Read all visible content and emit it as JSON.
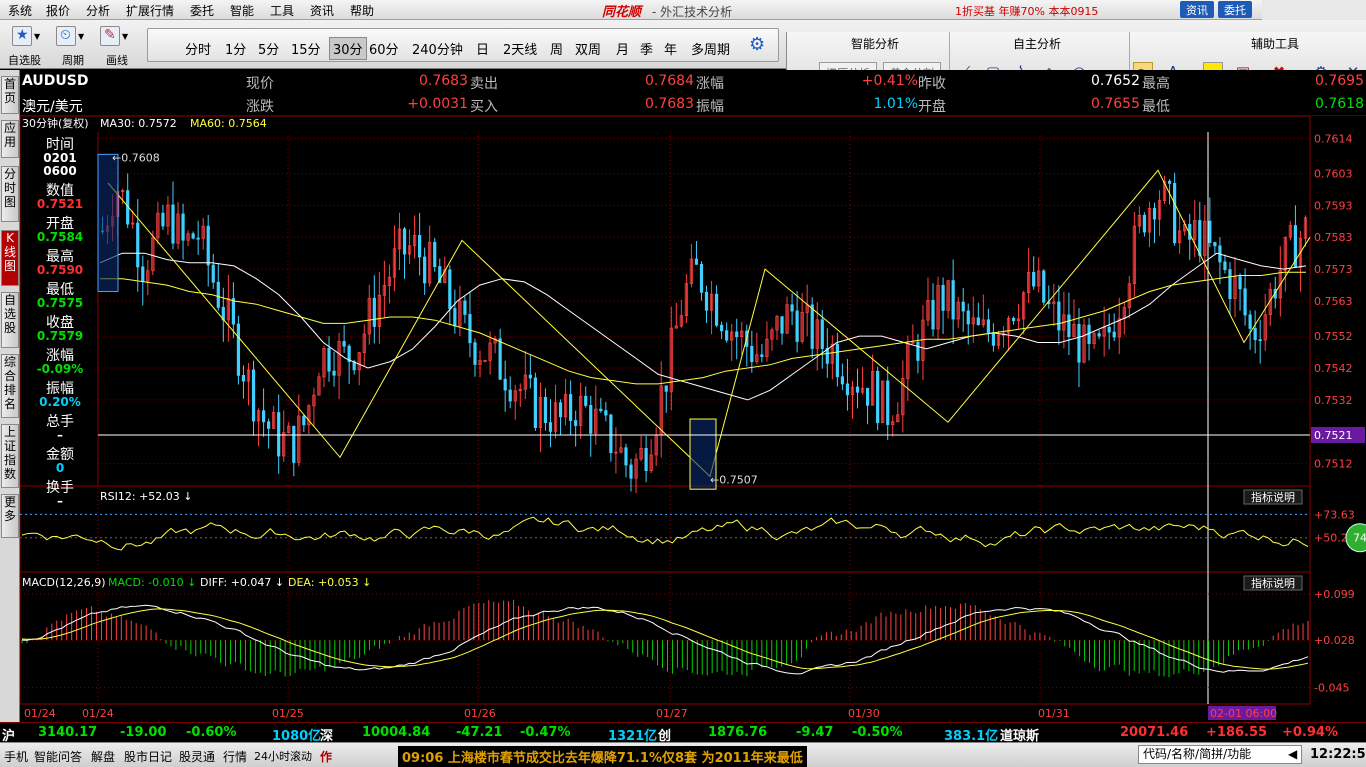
{
  "menu": [
    "系统",
    "报价",
    "分析",
    "扩展行情",
    "委托",
    "智能",
    "工具",
    "资讯",
    "帮助"
  ],
  "brand": "同花顺",
  "window_subtitle": "- 外汇技术分析",
  "promo_text": "1折买基 年赚70%   本本0915",
  "top_pills": [
    "资讯",
    "委托"
  ],
  "toolbar": {
    "left_buttons": [
      "自选股",
      "周期",
      "画线"
    ],
    "periods": [
      "分时",
      "1分",
      "5分",
      "15分",
      "30分",
      "60分",
      "240分钟",
      "日",
      "2天线",
      "周",
      "双周",
      "月",
      "季",
      "年",
      "多周期"
    ],
    "active_period": "30分",
    "panel_heads": [
      "智能分析",
      "自主分析",
      "辅助工具"
    ],
    "panel_buttons": [
      "撑压分析",
      "黄金分割"
    ]
  },
  "left_tabs": [
    "首页",
    "应用",
    "分时图",
    "K线图",
    "自选股",
    "综合排名",
    "上证指数",
    "更多"
  ],
  "quote": {
    "symbol": "AUDUSD",
    "name": "澳元/美元",
    "labels": {
      "now": "现价",
      "change": "涨跌",
      "sell": "卖出",
      "buy": "买入",
      "pct": "涨幅",
      "amp": "振幅",
      "prev": "昨收",
      "open": "开盘",
      "high": "最高",
      "low": "最低"
    },
    "values": {
      "now": "0.7683",
      "change": "+0.0031",
      "sell": "0.7684",
      "buy": "0.7683",
      "pct": "+0.41%",
      "amp": "1.01%",
      "prev": "0.7652",
      "open": "0.7655",
      "high": "0.7695",
      "low": "0.7618"
    }
  },
  "chart_header": {
    "period_label": "30分钟(复权)",
    "ma30": "MA30: 0.7572",
    "ma60": "MA60: 0.7564"
  },
  "info_panel": [
    {
      "label": "时间",
      "value": "0201\n0600",
      "color": "#ffffff"
    },
    {
      "label": "数值",
      "value": "0.7521",
      "color": "#ff3030"
    },
    {
      "label": "开盘",
      "value": "0.7584",
      "color": "#00e000"
    },
    {
      "label": "最高",
      "value": "0.7590",
      "color": "#ff3030"
    },
    {
      "label": "最低",
      "value": "0.7575",
      "color": "#00e000"
    },
    {
      "label": "收盘",
      "value": "0.7579",
      "color": "#00e000"
    },
    {
      "label": "涨幅",
      "value": "-0.09%",
      "color": "#00e000"
    },
    {
      "label": "振幅",
      "value": "0.20%",
      "color": "#00d0ff"
    },
    {
      "label": "总手",
      "value": "–",
      "color": "#ffffff"
    },
    {
      "label": "金额",
      "value": "0",
      "color": "#00d0ff"
    },
    {
      "label": "换手",
      "value": "–",
      "color": "#ffffff"
    }
  ],
  "chart_data": {
    "type": "candlestick",
    "price_ticks": [
      "0.7614",
      "0.7603",
      "0.7593",
      "0.7583",
      "0.7573",
      "0.7563",
      "0.7552",
      "0.7542",
      "0.7532",
      "0.7521",
      "0.7512"
    ],
    "ylim": [
      0.7505,
      0.7616
    ],
    "cursor_value": "0.7521",
    "high_marker": "0.7608",
    "low_marker": "0.7507",
    "x_labels": [
      "01/24",
      "01/24",
      "01/25",
      "01/26",
      "01/27",
      "01/30",
      "01/31",
      "02-01 06:00"
    ],
    "close_path": [
      0.7585,
      0.76,
      0.759,
      0.7575,
      0.7582,
      0.759,
      0.758,
      0.7585,
      0.7572,
      0.756,
      0.7548,
      0.7535,
      0.7525,
      0.752,
      0.7518,
      0.7525,
      0.7545,
      0.7548,
      0.7545,
      0.755,
      0.756,
      0.757,
      0.7578,
      0.758,
      0.7575,
      0.7568,
      0.756,
      0.7552,
      0.7548,
      0.7545,
      0.754,
      0.7535,
      0.753,
      0.7528,
      0.7525,
      0.753,
      0.7528,
      0.7522,
      0.7518,
      0.751,
      0.7515,
      0.7528,
      0.7545,
      0.7565,
      0.7572,
      0.7565,
      0.7558,
      0.7552,
      0.7548,
      0.7545,
      0.7555,
      0.756,
      0.7555,
      0.755,
      0.7548,
      0.7542,
      0.7538,
      0.7535,
      0.7528,
      0.7535,
      0.7548,
      0.7555,
      0.7565,
      0.756,
      0.7555,
      0.7552,
      0.7555,
      0.756,
      0.7565,
      0.7568,
      0.756,
      0.7555,
      0.7552,
      0.7545,
      0.7548,
      0.756,
      0.7575,
      0.759,
      0.7598,
      0.7592,
      0.758,
      0.7585,
      0.7578,
      0.7572,
      0.7566,
      0.7552,
      0.756,
      0.7572,
      0.758,
      0.7585
    ],
    "ma_fast": [
      0.7575,
      0.7578,
      0.7578,
      0.7576,
      0.7575,
      0.7575,
      0.7574,
      0.757,
      0.7565,
      0.7558,
      0.755,
      0.7545,
      0.7542,
      0.7544,
      0.7548,
      0.7555,
      0.7563,
      0.7568,
      0.757,
      0.7569,
      0.7565,
      0.756,
      0.7555,
      0.755,
      0.7545,
      0.754,
      0.7538,
      0.7536,
      0.7534,
      0.7532,
      0.7535,
      0.754,
      0.7545,
      0.755,
      0.7552,
      0.7552,
      0.755,
      0.7548,
      0.755,
      0.7552,
      0.7553,
      0.7552,
      0.755,
      0.755,
      0.7552,
      0.7555,
      0.7558,
      0.7562,
      0.7568,
      0.7573,
      0.7578,
      0.7576,
      0.7574,
      0.7573,
      0.7574
    ],
    "ma_slow": [
      0.757,
      0.757,
      0.7569,
      0.7568,
      0.7566,
      0.7565,
      0.7563,
      0.7562,
      0.756,
      0.7558,
      0.7556,
      0.7556,
      0.7557,
      0.7558,
      0.7558,
      0.7557,
      0.7555,
      0.7553,
      0.755,
      0.7547,
      0.7544,
      0.7541,
      0.7539,
      0.7538,
      0.7537,
      0.7537,
      0.7538,
      0.7539,
      0.7541,
      0.7542,
      0.7543,
      0.7545,
      0.7546,
      0.7547,
      0.7548,
      0.7549,
      0.755,
      0.7551,
      0.7551,
      0.7552,
      0.7553,
      0.7554,
      0.7555,
      0.7556,
      0.7558,
      0.756,
      0.7563,
      0.7566,
      0.7568,
      0.7569,
      0.757,
      0.7571,
      0.7571,
      0.7572,
      0.7572
    ],
    "zigzag": [
      0.76,
      0.7514,
      0.7582,
      0.7508,
      0.7573,
      0.7525,
      0.7604,
      0.755,
      0.7583
    ],
    "rsi": {
      "label": "RSI12: +52.03",
      "ticks": [
        "+73.63",
        "+50.27"
      ],
      "badge": "74"
    },
    "macd": {
      "label": "MACD(12,26,9)",
      "macd": "MACD: -0.010",
      "diff": "DIFF: +0.047",
      "dea": "DEA: +0.053",
      "ticks": [
        "+0.099",
        "+0.028",
        "-0.045"
      ]
    },
    "indicator_button": "指标说明"
  },
  "index_bar": [
    {
      "text": "沪",
      "color": "#ffffff"
    },
    {
      "text": "3140.17",
      "color": "#00e000"
    },
    {
      "text": "-19.00",
      "color": "#00e000"
    },
    {
      "text": "-0.60%",
      "color": "#00e000"
    },
    {
      "text": "1080亿",
      "color": "#00d0ff"
    },
    {
      "text": "深",
      "color": "#ffffff"
    },
    {
      "text": "10004.84",
      "color": "#00e000"
    },
    {
      "text": "-47.21",
      "color": "#00e000"
    },
    {
      "text": "-0.47%",
      "color": "#00e000"
    },
    {
      "text": "1321亿",
      "color": "#00d0ff"
    },
    {
      "text": "创",
      "color": "#ffffff"
    },
    {
      "text": "1876.76",
      "color": "#00e000"
    },
    {
      "text": "-9.47",
      "color": "#00e000"
    },
    {
      "text": "-0.50%",
      "color": "#00e000"
    },
    {
      "text": "383.1亿",
      "color": "#00d0ff"
    },
    {
      "text": "道琼斯",
      "color": "#ffffff"
    },
    {
      "text": "20071.46",
      "color": "#ff3030"
    },
    {
      "text": "+186.55",
      "color": "#ff3030"
    },
    {
      "text": "+0.94%",
      "color": "#ff3030"
    }
  ],
  "status_bar": {
    "items": [
      "手机",
      "智能问答",
      "解盘",
      "股市日记",
      "股灵通",
      "行情",
      "24小时滚动",
      "作"
    ],
    "ticker": "09:06 上海楼市春节成交比去年爆降71.1%仅8套 为2011年来最低",
    "search_placeholder": "代码/名称/简拼/功能",
    "clock": "12:22:56"
  },
  "colors": {
    "up": "#ff4040",
    "down": "#40d0ff",
    "grid": "#7a0000",
    "ma": "#ffffff",
    "ma_slow": "#ffff40",
    "zigzag": "#ffff40"
  }
}
